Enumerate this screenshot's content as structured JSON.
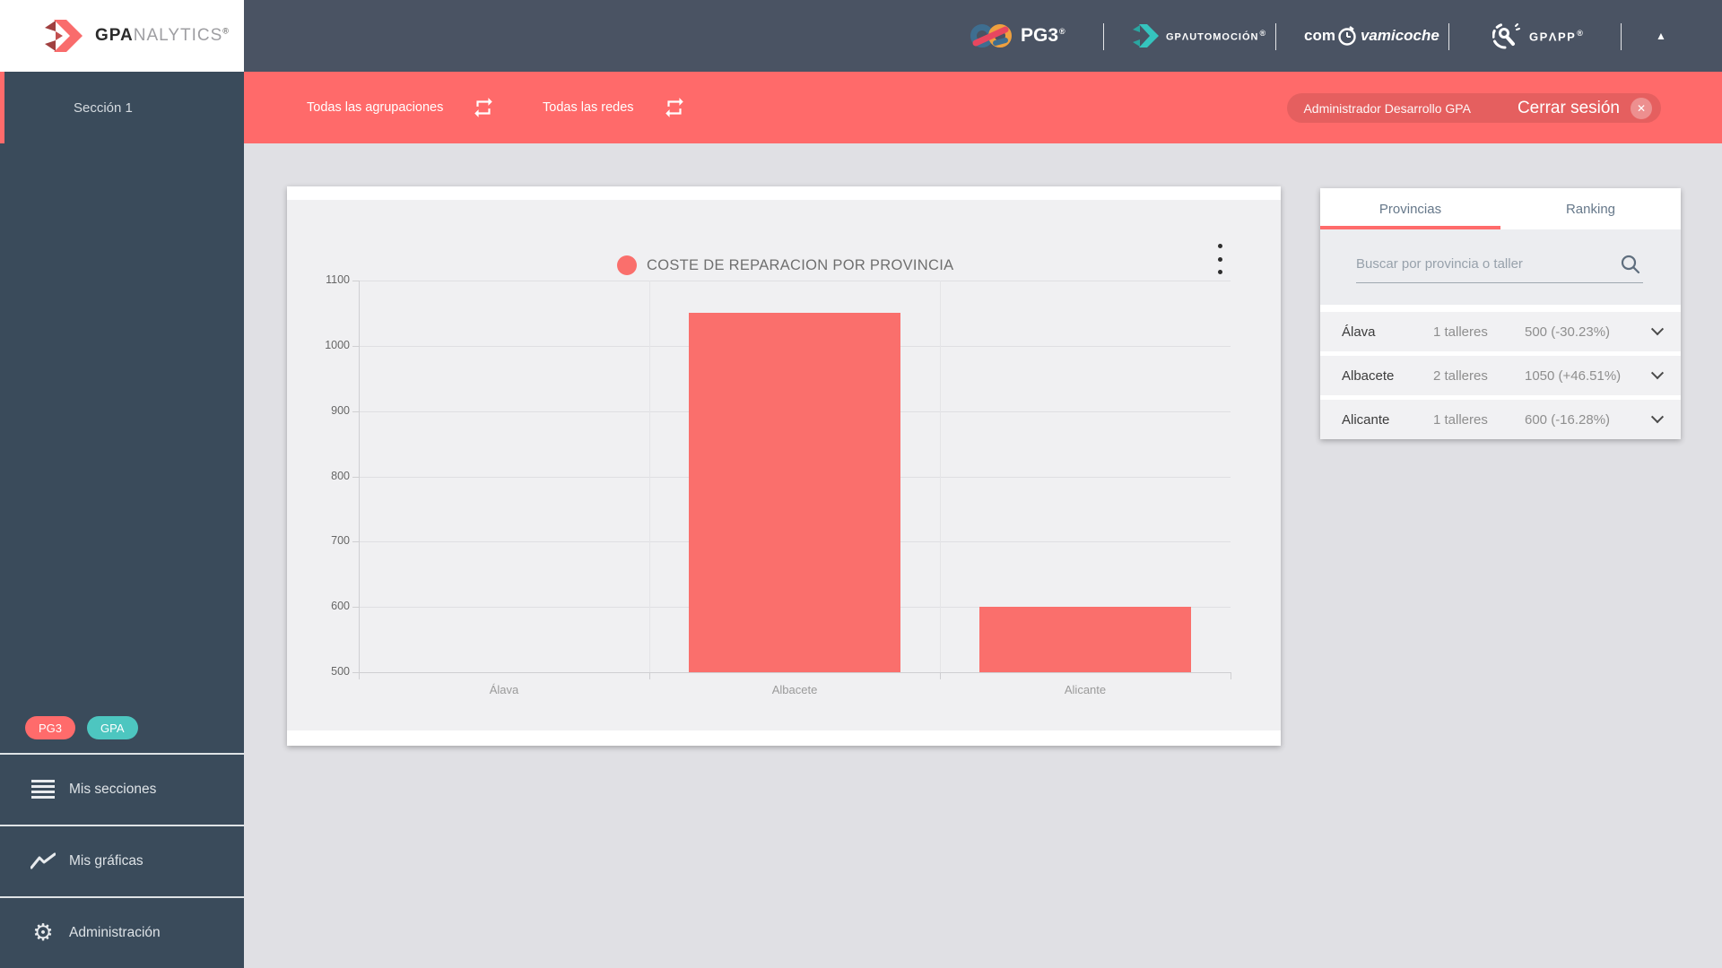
{
  "colors": {
    "accent_red": "#FF6B6B",
    "bar_red": "#FA6F6C",
    "teal": "#4DC6C0",
    "header_bg": "#4A5363",
    "sidebar_bg": "#3A4B5B",
    "page_bg": "#E0E0E4"
  },
  "brand": {
    "analytics": {
      "bold": "GPA",
      "light": "NALYTICS",
      "reg": "®"
    }
  },
  "header": {
    "logos": {
      "pg3": {
        "text": "PG3",
        "reg": "®"
      },
      "gpauto": {
        "text": "GPΛUTOMOCIÓN",
        "reg": "®"
      },
      "comprova": {
        "pre": "com",
        "post": "vamicoche"
      },
      "gpapp": {
        "text": "GPΛPP",
        "reg": "®"
      }
    },
    "collapse_glyph": "▲"
  },
  "filterbar": {
    "group_label": "Todas las agrupaciones",
    "network_label": "Todas las redes",
    "user_name": "Administrador Desarrollo GPA",
    "logout_label": "Cerrar sesión",
    "logout_x": "✕"
  },
  "sidebar": {
    "section_label": "Sección 1",
    "badges": [
      {
        "label": "PG3",
        "color": "#FF6B6B"
      },
      {
        "label": "GPA",
        "color": "#4DC6C0"
      }
    ],
    "menu": [
      {
        "label": "Mis secciones",
        "icon": "list-icon"
      },
      {
        "label": "Mis gráficas",
        "icon": "chart-line-icon"
      },
      {
        "label": "Administración",
        "icon": "gear-icon"
      }
    ]
  },
  "chart_data": {
    "type": "bar",
    "title": "COSTE DE REPARACION POR PROVINCIA",
    "categories": [
      "Álava",
      "Albacete",
      "Alicante"
    ],
    "values": [
      500,
      1050,
      600
    ],
    "xlabel": "",
    "ylabel": "",
    "ylim": [
      500,
      1100
    ],
    "ytick_step": 100,
    "grid": true,
    "bar_color": "#FA6F6C",
    "legend_marker_color": "#FA6F6C",
    "legend_position": "top-center"
  },
  "panel": {
    "tabs": [
      {
        "label": "Provincias",
        "active": true
      },
      {
        "label": "Ranking",
        "active": false
      }
    ],
    "search_placeholder": "Buscar por provincia o taller",
    "rows": [
      {
        "name": "Álava",
        "talleres": "1 talleres",
        "value": "500 (-30.23%)"
      },
      {
        "name": "Albacete",
        "talleres": "2 talleres",
        "value": "1050 (+46.51%)"
      },
      {
        "name": "Alicante",
        "talleres": "1 talleres",
        "value": "600 (-16.28%)"
      }
    ]
  }
}
